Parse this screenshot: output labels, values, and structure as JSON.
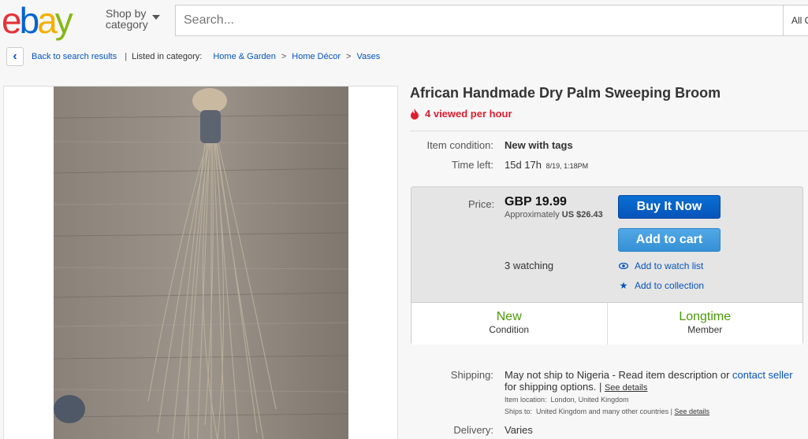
{
  "header": {
    "logo": {
      "e": "e",
      "b": "b",
      "a": "a",
      "y": "y"
    },
    "shop_by_line1": "Shop by",
    "shop_by_line2": "category",
    "search_placeholder": "Search...",
    "all_categories": "All Categories"
  },
  "breadcrumb": {
    "back_label": "Back to search results",
    "listed_in": "Listed in category:",
    "items": [
      "Home & Garden",
      "Home Décor",
      "Vases"
    ]
  },
  "item": {
    "title": "African Handmade Dry Palm Sweeping Broom",
    "viewed": "4 viewed per hour",
    "condition_label": "Item condition:",
    "condition_value": "New with tags",
    "time_left_label": "Time left:",
    "time_left_value": "15d 17h",
    "time_left_date": "8/19, 1:18PM"
  },
  "buybox": {
    "price_label": "Price:",
    "price": "GBP 19.99",
    "approx_prefix": "Approximately",
    "approx_value": "US $26.43",
    "buy_now": "Buy It Now",
    "add_to_cart": "Add to cart",
    "watching": "3 watching",
    "add_watch": "Add to watch list",
    "add_collection": "Add to collection",
    "badge_condition_big": "New",
    "badge_condition_small": "Condition",
    "badge_member_big": "Longtime",
    "badge_member_small": "Member"
  },
  "shipping": {
    "label": "Shipping:",
    "text_pre": "May not ship to Nigeria - Read item description or ",
    "contact_seller": "contact seller",
    "text_post": " for shipping options. | ",
    "see_details": "See details",
    "location_label": "Item location:",
    "location_value": "London, United Kingdom",
    "ships_to_label": "Ships to:",
    "ships_to_value": "United Kingdom and many other countries | ",
    "see_details_2": "See details"
  },
  "delivery": {
    "label": "Delivery:",
    "value": "Varies"
  },
  "colors": {
    "link_blue": "#0654ba",
    "alert_red": "#dd1e31",
    "badge_green": "#4c9a09"
  }
}
